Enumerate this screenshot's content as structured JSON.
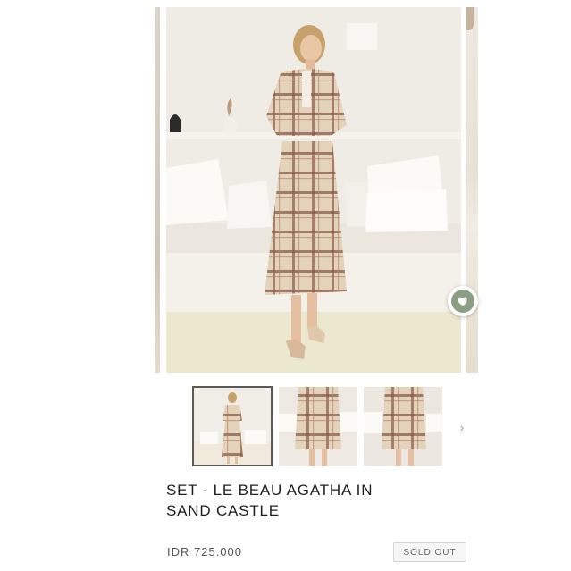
{
  "product": {
    "title_line1": "SET - LE BEAU AGATHA IN",
    "title_line2": "SAND CASTLE",
    "price": "IDR 725.000",
    "status_badge": "SOLD OUT"
  },
  "gallery": {
    "thumbnail_count": 3,
    "active_thumbnail": 1,
    "next_arrow": "›"
  },
  "icons": {
    "wishlist": "heart-icon",
    "thumbnails_next": "chevron-right-icon"
  },
  "colors": {
    "wishlist_accent": "#8a9e82",
    "plaid_base": "#e3d3bb",
    "plaid_stripe": "#8a5a4a"
  }
}
